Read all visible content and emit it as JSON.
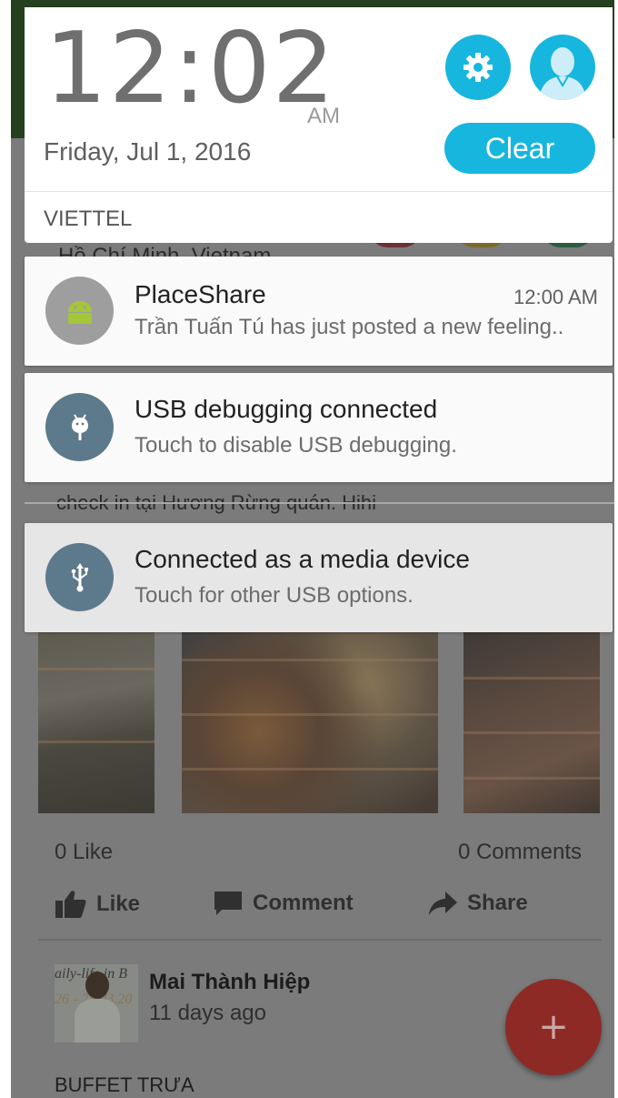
{
  "shade": {
    "clock": "12:02",
    "ampm": "AM",
    "date": "Friday, Jul 1, 2016",
    "clear_label": "Clear",
    "carrier": "VIETTEL",
    "colors": {
      "accent": "#17b6de"
    }
  },
  "notifications": [
    {
      "app": "PlaceShare",
      "time": "12:00 AM",
      "text": "Trần Tuấn Tú has just posted a new feeling..",
      "icon": "android-icon"
    },
    {
      "title": "USB debugging connected",
      "text": "Touch to disable USB debugging.",
      "icon": "debug-icon"
    },
    {
      "title": "Connected as a media device",
      "text": "Touch for other USB options.",
      "icon": "usb-icon"
    }
  ],
  "background_app": {
    "location_text": "Hồ Chí Minh, Vietnam",
    "checkin_text": "check in tại Hương Rừng quán. Hihi",
    "like_count": "0 Like",
    "comment_count": "0 Comments",
    "actions": {
      "like": "Like",
      "comment": "Comment",
      "share": "Share"
    },
    "author": "Mai Thành Hiệp",
    "author_time": "11 days ago",
    "avatar_text_1": "aily-life in B",
    "avatar_text_2": "26 - 27.03.20",
    "post_caption": "BUFFET TRƯA",
    "fab_label": "+"
  }
}
